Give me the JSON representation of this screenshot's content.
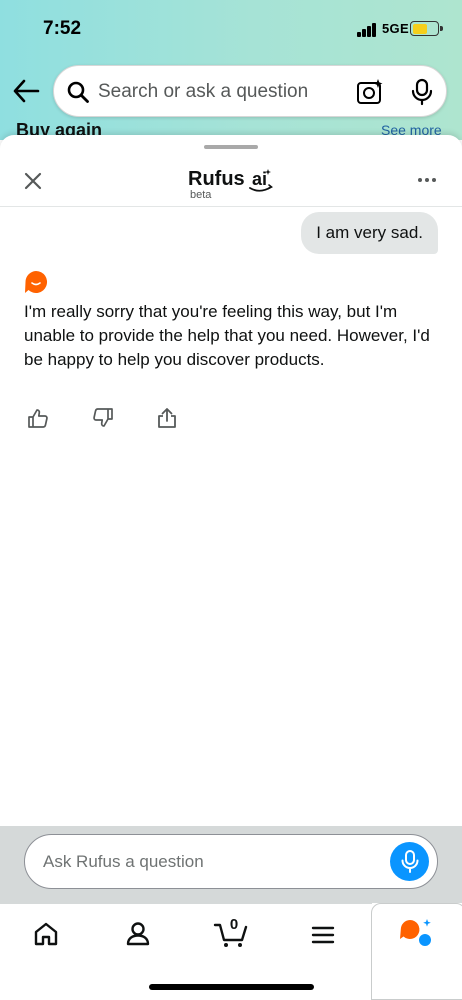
{
  "status_bar": {
    "time": "7:52",
    "network": "5GE",
    "battery_level": 0.6,
    "battery_color": "#f5cf1c"
  },
  "header": {
    "back_icon": "back-arrow-icon",
    "search_placeholder": "Search or ask a question",
    "search_icon": "search-icon",
    "camera_icon": "camera-sparkle-icon",
    "mic_icon": "microphone-icon",
    "behind_title": "Buy again",
    "behind_link": "See more"
  },
  "sheet": {
    "title": "Rufus",
    "logo": "ai",
    "badge": "beta",
    "close_icon": "close-icon",
    "more_icon": "more-options-icon"
  },
  "conversation": {
    "user_message": "I am very sad.",
    "bot_message": "I'm really sorry that you're feeling this way, but I'm unable to provide the help that you need. However, I'd be happy to help you discover products.",
    "feedback_icons": [
      "thumbs-up-icon",
      "thumbs-down-icon",
      "share-icon"
    ]
  },
  "composer": {
    "placeholder": "Ask Rufus a question",
    "mic_icon": "microphone-icon",
    "accent_color": "#0a95ff"
  },
  "tab_bar": {
    "tabs": [
      "home-icon",
      "account-icon",
      "cart-icon",
      "menu-icon",
      "rufus-icon"
    ],
    "cart_count": "0",
    "rufus_accent": "#ff6200"
  }
}
